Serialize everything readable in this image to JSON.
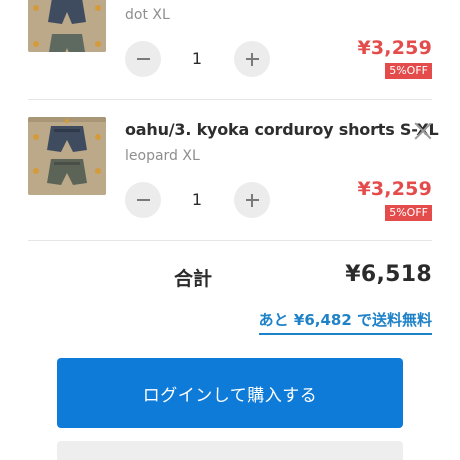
{
  "cart": {
    "items": [
      {
        "name": "",
        "variant": "dot XL",
        "quantity": "1",
        "price": "¥3,259",
        "discount": "5%OFF",
        "thumb_icon": "shorts-product-image"
      },
      {
        "name": "oahu/3. kyoka corduroy shorts S-XL",
        "variant": "leopard XL",
        "quantity": "1",
        "price": "¥3,259",
        "discount": "5%OFF",
        "thumb_icon": "shorts-product-image"
      }
    ],
    "icons": {
      "decrement": "minus-icon",
      "increment": "plus-icon",
      "remove": "close-icon"
    }
  },
  "summary": {
    "total_label": "合計",
    "total_value": "¥6,518",
    "free_shipping_text": "あと ¥6,482 で送料無料"
  },
  "actions": {
    "login_purchase_label": "ログインして購入する",
    "secondary_label": ""
  },
  "colors": {
    "price": "#e44c4c",
    "link": "#1f82c8",
    "primary_button": "#0e7bd9"
  }
}
